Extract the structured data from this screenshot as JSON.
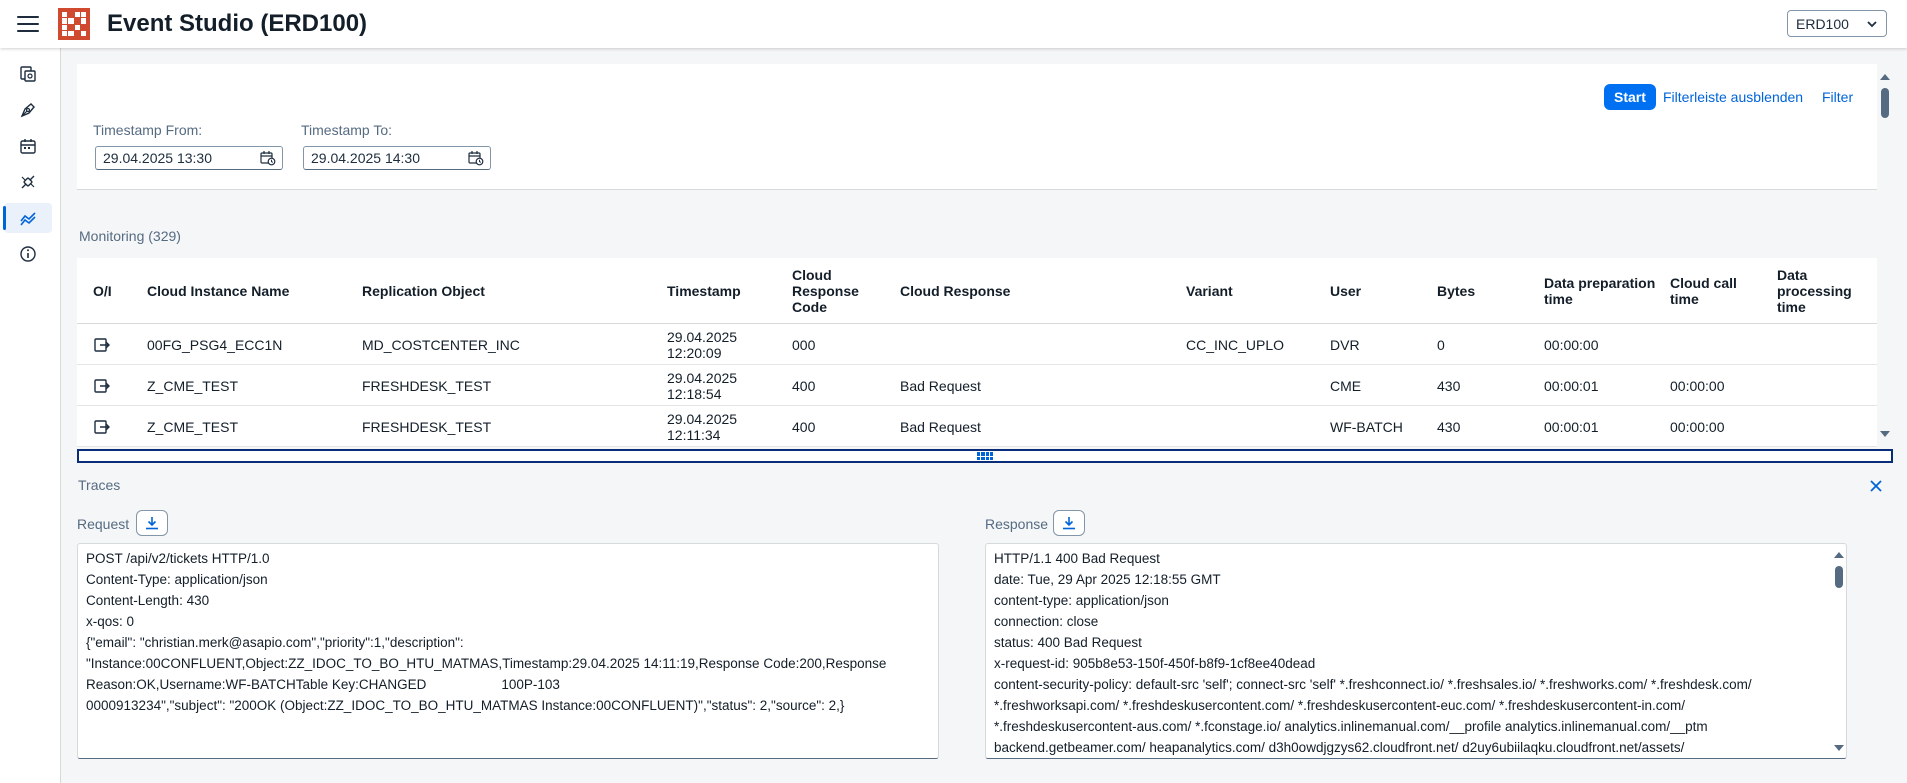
{
  "shell": {
    "title": "Event Studio (ERD100)",
    "system_select": "ERD100"
  },
  "sidenav": {
    "items": [
      {
        "icon": "document-copy-icon"
      },
      {
        "icon": "pen-nib-icon"
      },
      {
        "icon": "calendar-icon"
      },
      {
        "icon": "connector-icon"
      },
      {
        "icon": "line-chart-icon"
      },
      {
        "icon": "info-icon"
      }
    ],
    "active_index": 4
  },
  "filterbar": {
    "start_label": "Start",
    "hide_label": "Filterleiste ausblenden",
    "filter_label": "Filter",
    "from_label": "Timestamp From:",
    "from_value": "29.04.2025 13:30",
    "to_label": "Timestamp To:",
    "to_value": "29.04.2025 14:30"
  },
  "monitoring": {
    "title": "Monitoring (329)",
    "columns": {
      "oi": "O/I",
      "instance": "Cloud Instance Name",
      "object": "Replication Object",
      "timestamp": "Timestamp",
      "code": "Cloud Response Code",
      "response": "Cloud Response",
      "variant": "Variant",
      "user": "User",
      "bytes": "Bytes",
      "prep": "Data preparation time",
      "call": "Cloud call time",
      "proc": "Data processing time"
    },
    "rows": [
      {
        "instance": "00FG_PSG4_ECC1N",
        "object": "MD_COSTCENTER_INC",
        "ts_date": "29.04.2025",
        "ts_time": "12:20:09",
        "code": "000",
        "response": "",
        "variant": "CC_INC_UPLO",
        "user": "DVR",
        "bytes": "0",
        "prep": "00:00:00",
        "call": "",
        "proc": ""
      },
      {
        "instance": "Z_CME_TEST",
        "object": "FRESHDESK_TEST",
        "ts_date": "29.04.2025",
        "ts_time": "12:18:54",
        "code": "400",
        "response": "Bad Request",
        "variant": "",
        "user": "CME",
        "bytes": "430",
        "prep": "00:00:01",
        "call": "00:00:00",
        "proc": ""
      },
      {
        "instance": "Z_CME_TEST",
        "object": "FRESHDESK_TEST",
        "ts_date": "29.04.2025",
        "ts_time": "12:11:34",
        "code": "400",
        "response": "Bad Request",
        "variant": "",
        "user": "WF-BATCH",
        "bytes": "430",
        "prep": "00:00:01",
        "call": "00:00:00",
        "proc": ""
      }
    ]
  },
  "traces": {
    "title": "Traces",
    "request_label": "Request",
    "response_label": "Response",
    "request_lines": [
      "POST /api/v2/tickets HTTP/1.0",
      "Content-Type: application/json",
      "Content-Length: 430",
      "x-qos: 0",
      "",
      "{\"email\": \"christian.merk@asapio.com\",\"priority\":1,\"description\":",
      "\"Instance:00CONFLUENT,Object:ZZ_IDOC_TO_BO_HTU_MATMAS,Timestamp:29.04.2025 14:11:19,Response Code:200,Response",
      "Reason:OK,Username:WF-BATCHTable Key:CHANGED                    100P-103",
      "0000913234\",\"subject\": \"200OK (Object:ZZ_IDOC_TO_BO_HTU_MATMAS Instance:00CONFLUENT)\",\"status\": 2,\"source\": 2,}"
    ],
    "response_lines": [
      "HTTP/1.1 400 Bad Request",
      "date: Tue, 29 Apr 2025 12:18:55 GMT",
      "content-type: application/json",
      "connection: close",
      "status: 400 Bad Request",
      "x-request-id: 905b8e53-150f-450f-b8f9-1cf8ee40dead",
      "content-security-policy: default-src 'self'; connect-src 'self' *.freshconnect.io/ *.freshsales.io/ *.freshworks.com/ *.freshdesk.com/",
      "*.freshworksapi.com/ *.freshdeskusercontent.com/ *.freshdeskusercontent-euc.com/ *.freshdeskusercontent-in.com/",
      "*.freshdeskusercontent-aus.com/ *.fconstage.io/ analytics.inlinemanual.com/__profile analytics.inlinemanual.com/__ptm",
      "backend.getbeamer.com/ heapanalytics.com/ d3h0owdjgzys62.cloudfront.net/ d2uy6ubiilaqku.cloudfront.net/assets/"
    ]
  },
  "colors": {
    "accent": "#0070f2",
    "link": "#0064d9",
    "logo": "#d04a30",
    "splitter": "#0a2d7a"
  }
}
